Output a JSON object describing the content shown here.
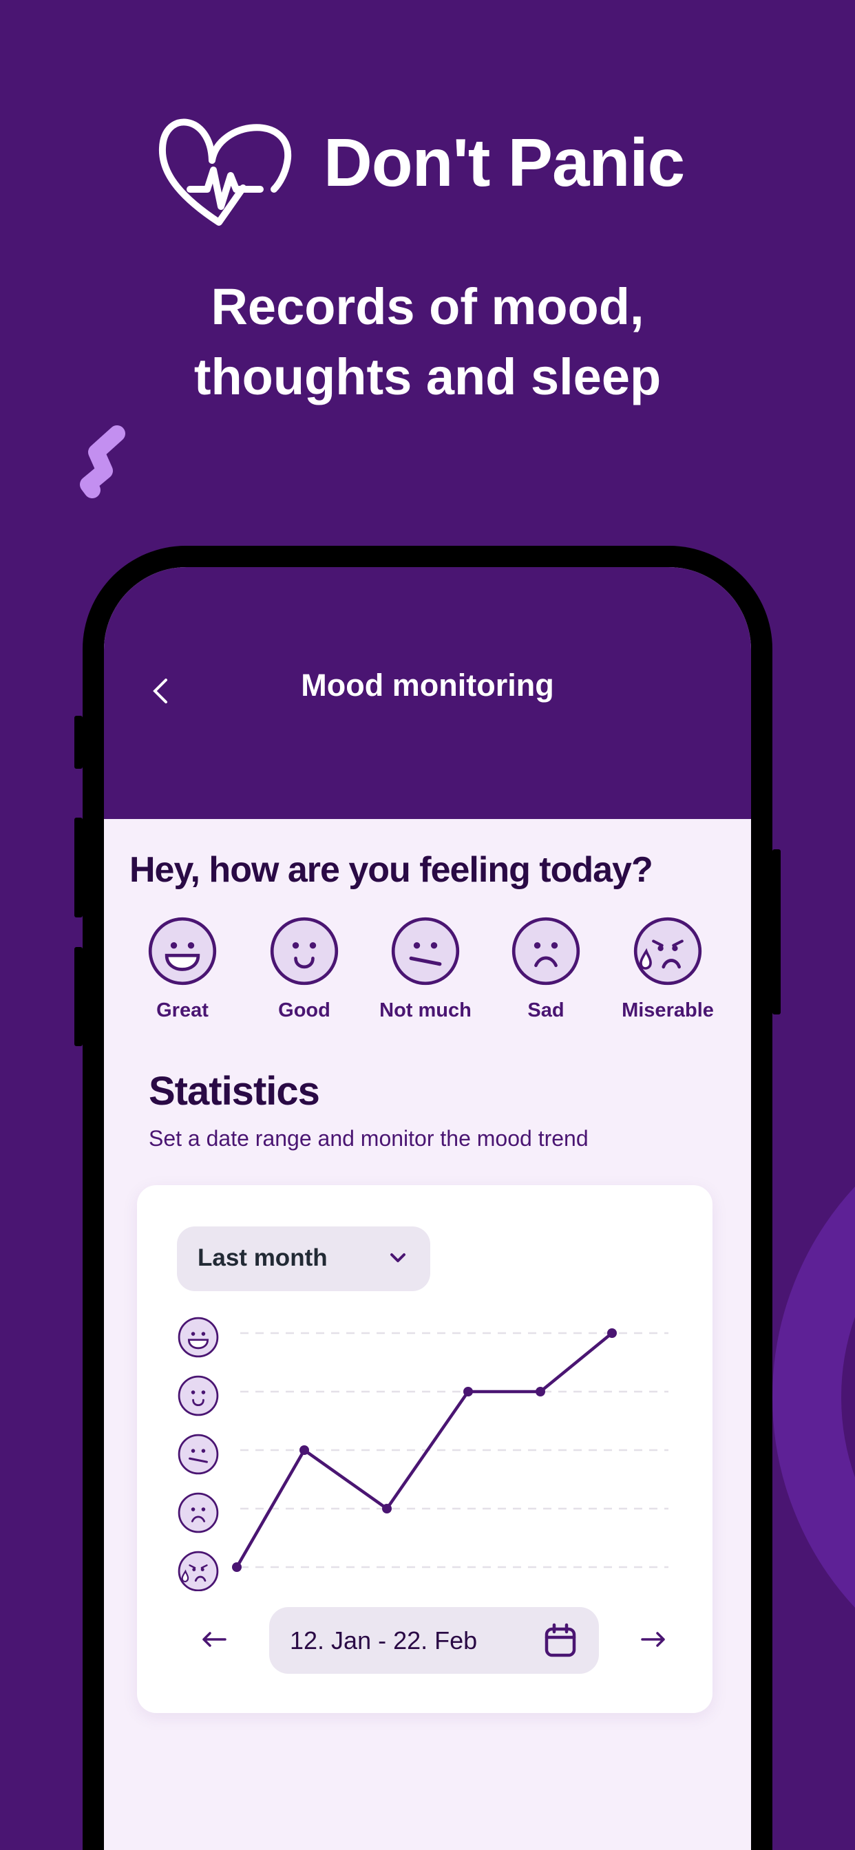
{
  "promo": {
    "app_name": "Don't Panic",
    "tagline_line1": "Records of mood,",
    "tagline_line2": "thoughts and sleep",
    "logo_icon": "heart-pulse-icon"
  },
  "colors": {
    "background": "#4a1572",
    "accent": "#4a1572",
    "emoji_fill": "#e6d9f2",
    "text_dark": "#2a0a45",
    "decor_light": "#c38ff0",
    "decor_arc": "#5e2196"
  },
  "header": {
    "title": "Mood monitoring",
    "back_icon": "chevron-left-icon"
  },
  "question": "Hey, how are you feeling today?",
  "moods": [
    {
      "label": "Great",
      "icon": "great"
    },
    {
      "label": "Good",
      "icon": "good"
    },
    {
      "label": "Not much",
      "icon": "meh"
    },
    {
      "label": "Sad",
      "icon": "sad"
    },
    {
      "label": "Miserable",
      "icon": "miserable"
    }
  ],
  "statistics": {
    "title": "Statistics",
    "subtitle": "Set a date range and monitor the mood trend",
    "range_select": "Last month",
    "date_range": "12. Jan - 22. Feb"
  },
  "chart_data": {
    "type": "line",
    "y_levels": [
      "Miserable",
      "Sad",
      "Not much",
      "Good",
      "Great"
    ],
    "ylim": [
      1,
      5
    ],
    "values": [
      1,
      3,
      2,
      4,
      4,
      5
    ],
    "grid": true
  }
}
